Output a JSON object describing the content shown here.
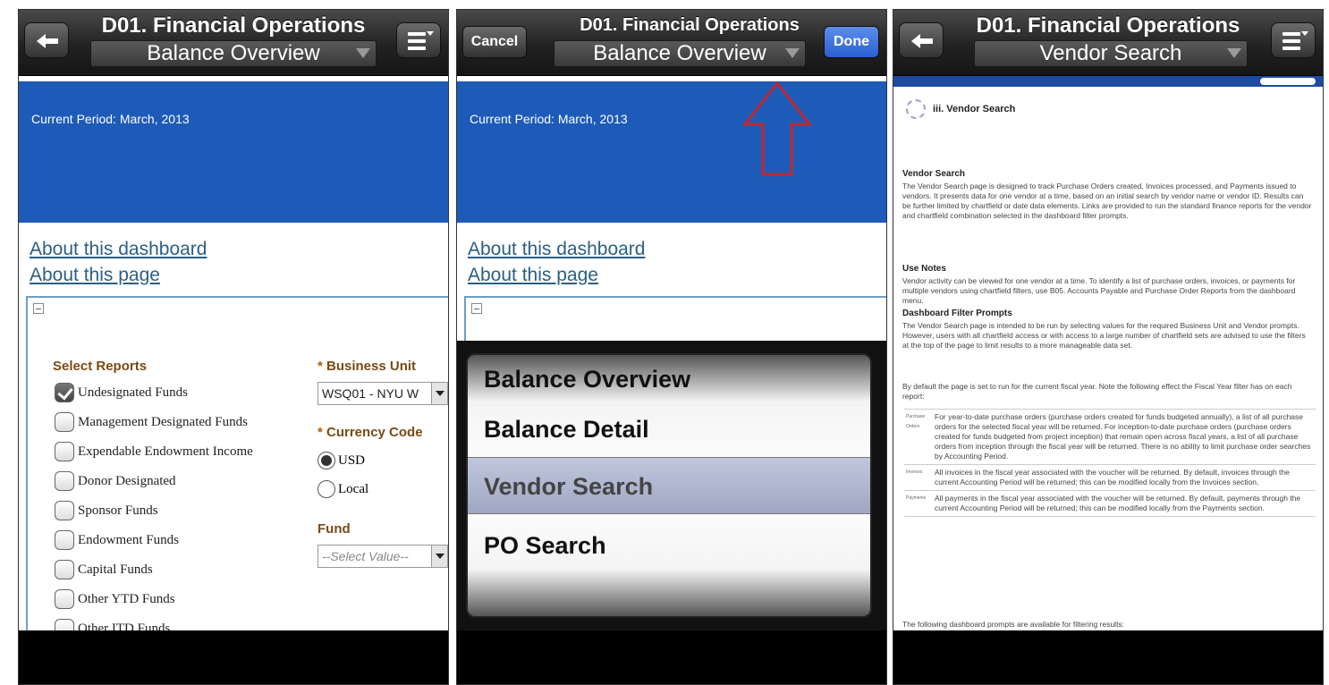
{
  "app_title": "D01. Financial Operations",
  "panels": [
    {
      "page_select": "Balance Overview",
      "banner_text": "Current Period: March, 2013",
      "about_dashboard": "About this dashboard",
      "about_page": "About this page",
      "select_reports_title": "Select Reports",
      "reports": [
        {
          "label": "Undesignated Funds",
          "checked": true
        },
        {
          "label": "Management Designated Funds",
          "checked": false
        },
        {
          "label": "Expendable Endowment Income",
          "checked": false
        },
        {
          "label": "Donor Designated",
          "checked": false
        },
        {
          "label": "Sponsor Funds",
          "checked": false
        },
        {
          "label": "Endowment Funds",
          "checked": false
        },
        {
          "label": "Capital Funds",
          "checked": false
        },
        {
          "label": "Other YTD Funds",
          "checked": false
        },
        {
          "label": "Other ITD Funds",
          "checked": false
        }
      ],
      "business_unit_label": "Business Unit",
      "business_unit_value": "WSQ01 - NYU W",
      "currency_label": "Currency Code",
      "currency_options": [
        "USD",
        "Local"
      ],
      "fund_label": "Fund",
      "fund_placeholder": "--Select Value--",
      "required_mark": "*"
    },
    {
      "cancel_label": "Cancel",
      "done_label": "Done",
      "page_select": "Balance Overview",
      "banner_text": "Current Period: March, 2013",
      "about_dashboard": "About this dashboard",
      "about_page": "About this page",
      "picker_items": [
        "Balance Overview",
        "Balance Detail",
        "Vendor Search",
        "PO Search"
      ]
    },
    {
      "page_select": "Vendor Search",
      "doc_title": "iii. Vendor Search",
      "sections": [
        {
          "heading": "Vendor Search",
          "text": "The Vendor Search page is designed to track Purchase Orders created, Invoices processed, and Payments issued to vendors. It presents data for one vendor at a time, based on an initial search by vendor name or vendor ID. Results can be further limited by chartfield or date data elements. Links are provided to run the standard finance reports for the vendor and chartfield combination selected in the dashboard filter prompts."
        },
        {
          "heading": "Use Notes",
          "text": "Vendor activity can be viewed for one vendor at a time. To identify a list of purchase orders, invoices, or payments for multiple vendors using chartfield filters, use B05. Accounts Payable and Purchase Order Reports from the dashboard menu."
        },
        {
          "heading": "Dashboard Filter Prompts",
          "text": "The Vendor Search page is intended to be run by selecting values for the required Business Unit and Vendor prompts. However, users with all chartfield access or with access to a large number of chartfield sets are advised to use the filters at the top of the page to limit results to a more manageable data set."
        }
      ],
      "fiscal_note": "By default the page is set to run for the current fiscal year. Note the following effect the Fiscal Year filter has on each report:",
      "table_rows": [
        {
          "key": "Purchase Orders",
          "text": "For year-to-date purchase orders (purchase orders created for funds budgeted annually), a list of all purchase orders for the selected fiscal year will be returned. For inception-to-date purchase orders (purchase orders created for funds budgeted from project inception) that remain open across fiscal years, a list of all purchase orders from inception through the fiscal year will be returned. There is no ability to limit purchase order searches by Accounting Period."
        },
        {
          "key": "Invoices",
          "text": "All invoices in the fiscal year associated with the voucher will be returned. By default, invoices through the current Accounting Period will be returned; this can be modified locally from the Invoices section."
        },
        {
          "key": "Payments",
          "text": "All payments in the fiscal year associated with the voucher will be returned. By default, payments through the current Accounting Period will be returned; this can be modified locally from the Payments section."
        }
      ],
      "footer_text": "The following dashboard prompts are available for filtering results:"
    }
  ],
  "colors": {
    "banner": "#1e5bb8",
    "link": "#2b5f86",
    "done": "#2960d4",
    "arrow": "#c0282d"
  }
}
